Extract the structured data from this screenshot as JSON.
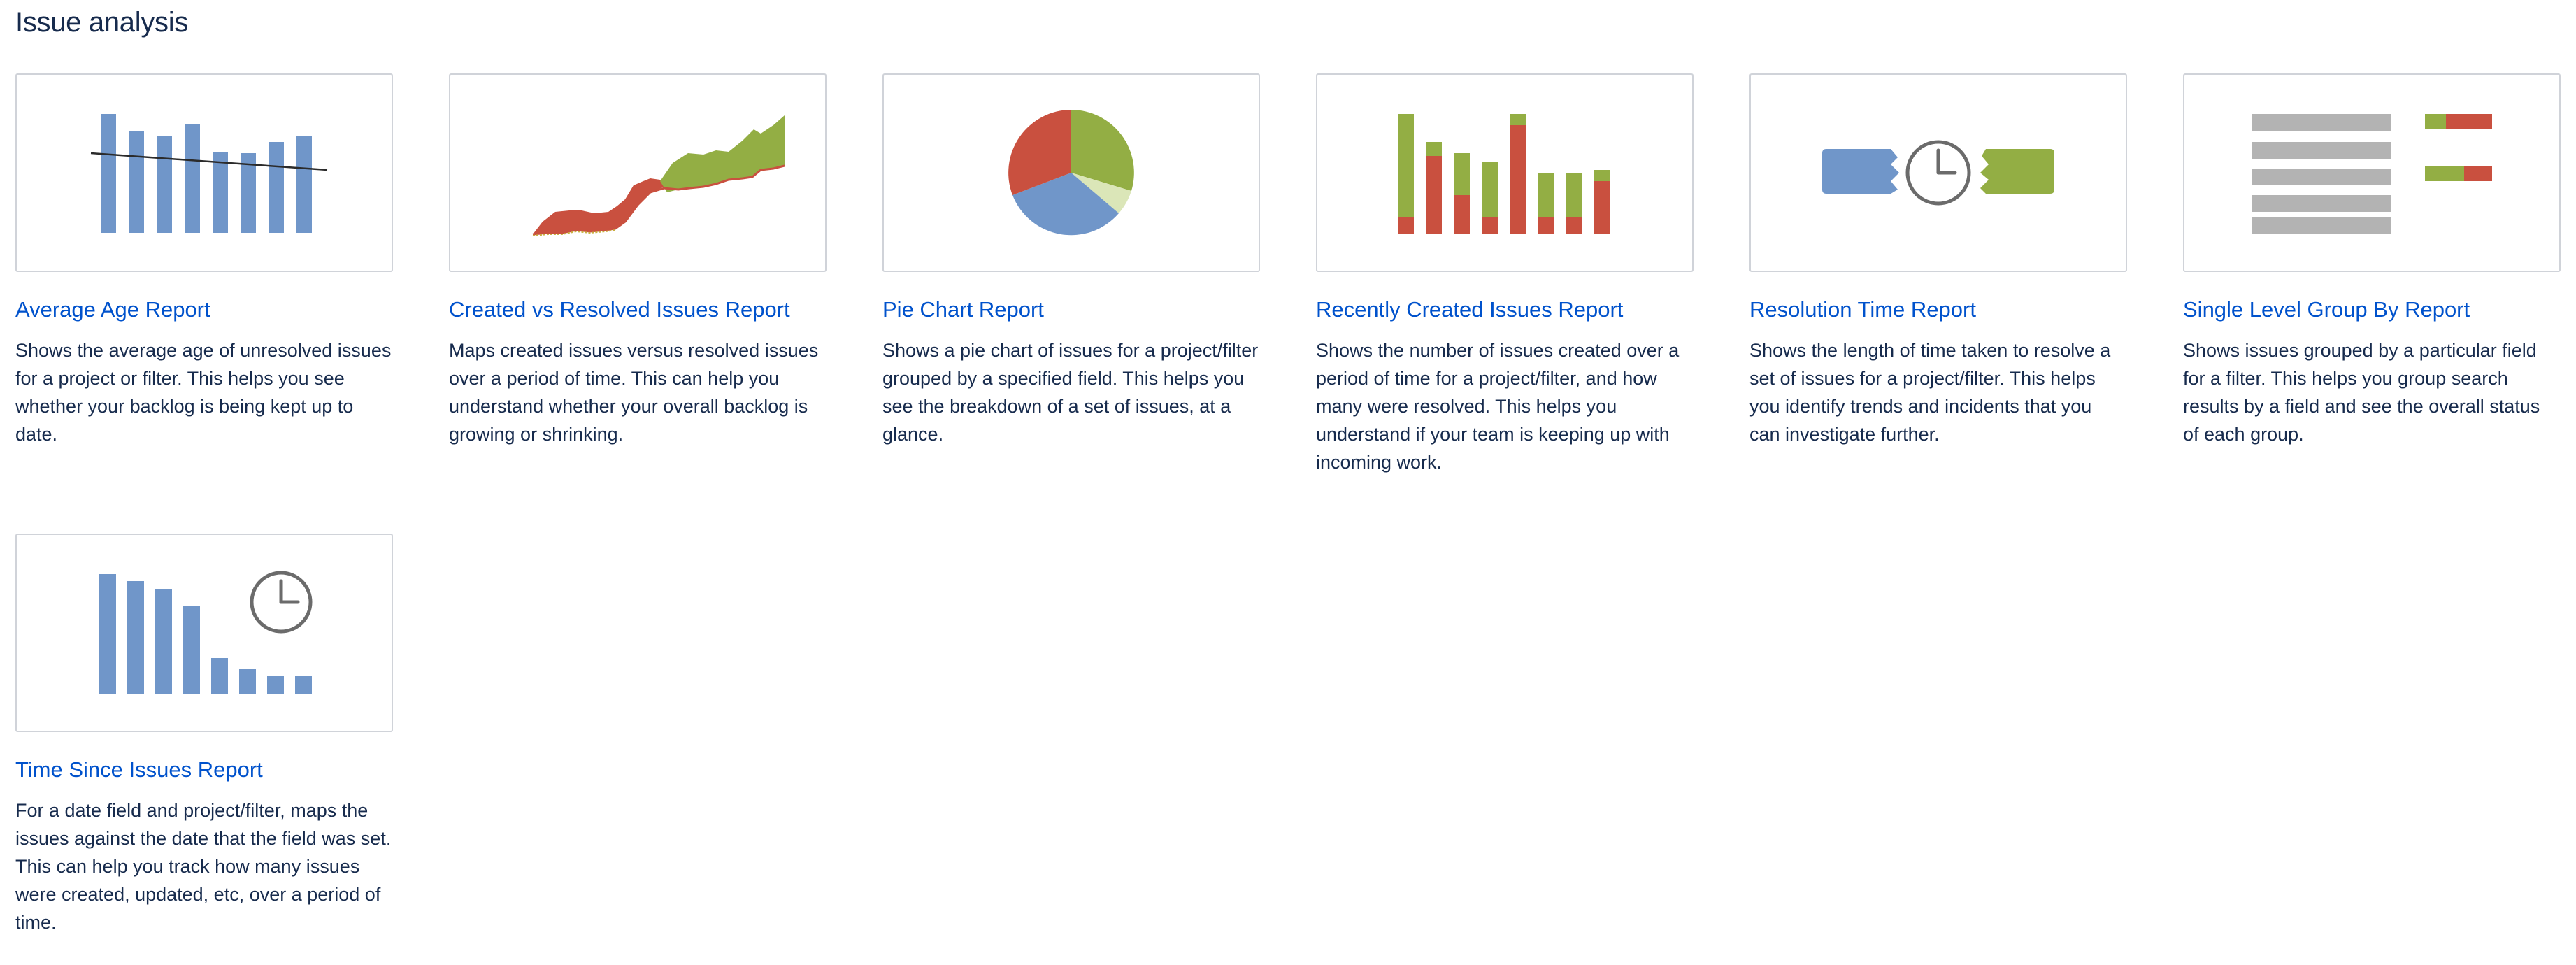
{
  "section": {
    "title": "Issue analysis"
  },
  "colors": {
    "link": "#0052cc",
    "text": "#172b4d",
    "blue": "#7096c9",
    "green": "#93ae44",
    "red": "#c9503f",
    "grey": "#b3b3b3"
  },
  "reports": [
    {
      "title": "Average Age Report",
      "description": "Shows the average age of unresolved issues for a project or filter. This helps you see whether your backlog is being kept up to date.",
      "icon": "average-age-bar-chart-icon"
    },
    {
      "title": "Created vs Resolved Issues Report",
      "description": "Maps created issues versus resolved issues over a period of time. This can help you understand whether your overall backlog is growing or shrinking.",
      "icon": "created-vs-resolved-area-chart-icon"
    },
    {
      "title": "Pie Chart Report",
      "description": "Shows a pie chart of issues for a project/filter grouped by a specified field. This helps you see the breakdown of a set of issues, at a glance.",
      "icon": "pie-chart-icon"
    },
    {
      "title": "Recently Created Issues Report",
      "description": "Shows the number of issues created over a period of time for a project/filter, and how many were resolved. This helps you understand if your team is keeping up with incoming work.",
      "icon": "stacked-bar-chart-icon"
    },
    {
      "title": "Resolution Time Report",
      "description": "Shows the length of time taken to resolve a set of issues for a project/filter. This helps you identify trends and incidents that you can investigate further.",
      "icon": "resolution-clock-icon"
    },
    {
      "title": "Single Level Group By Report",
      "description": "Shows issues grouped by a particular field for a filter. This helps you group search results by a field and see the overall status of each group.",
      "icon": "group-by-list-icon"
    },
    {
      "title": "Time Since Issues Report",
      "description": "For a date field and project/filter, maps the issues against the date that the field was set. This can help you track how many issues were created, updated, etc, over a period of time.",
      "icon": "time-since-bar-clock-icon"
    }
  ]
}
